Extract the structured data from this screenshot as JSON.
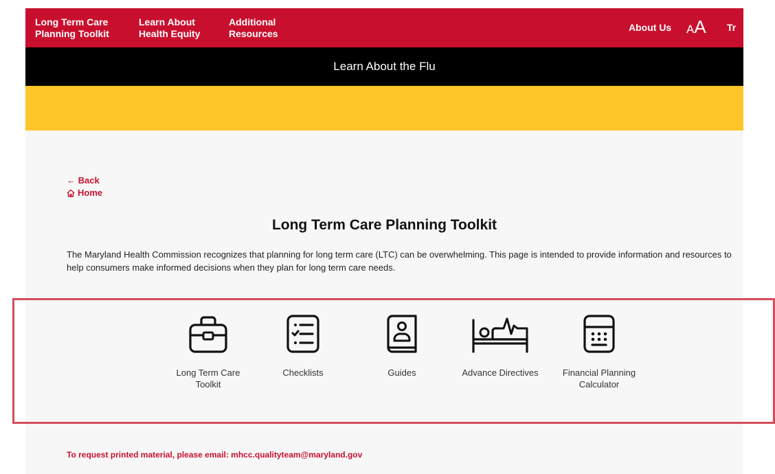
{
  "nav": {
    "ltc": [
      "Long Term Care",
      "Planning Toolkit"
    ],
    "health_equity": [
      "Learn About",
      "Health Equity"
    ],
    "resources": [
      "Additional",
      "Resources"
    ],
    "about": "About Us",
    "text_size": "AA",
    "translate": "Tr"
  },
  "banner": {
    "text": "Learn About the Flu"
  },
  "links": {
    "back": "← Back",
    "home": "Home"
  },
  "main": {
    "title": "Long Term Care Planning Toolkit",
    "intro": "The Maryland Health Commission recognizes that planning for long term care (LTC) can be overwhelming. This page is intended to provide information and resources to help consumers make informed decisions when they plan for long term care needs."
  },
  "tools": [
    {
      "label": "Long Term Care Toolkit",
      "icon": "briefcase-icon"
    },
    {
      "label": "Checklists",
      "icon": "checklist-icon"
    },
    {
      "label": "Guides",
      "icon": "guide-book-icon"
    },
    {
      "label": "Advance Directives",
      "icon": "bed-heartbeat-icon"
    },
    {
      "label": "Financial Planning Calculator",
      "icon": "calculator-icon"
    }
  ],
  "footer": {
    "email_text": "To request printed material, please email: mhcc.qualityteam@maryland.gov"
  },
  "colors": {
    "brand_red": "#c8102e",
    "banner_black": "#000000",
    "accent_yellow": "#ffc629",
    "highlight": "#d54b5b"
  }
}
